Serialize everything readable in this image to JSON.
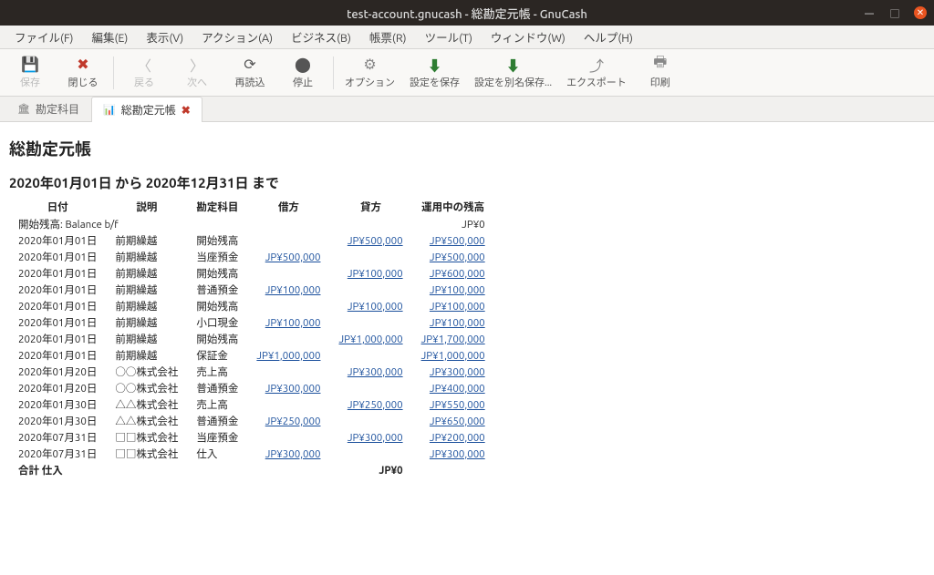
{
  "window": {
    "title": "test-account.gnucash - 総勘定元帳 - GnuCash"
  },
  "menu": {
    "file": "ファイル(F)",
    "edit": "編集(E)",
    "view": "表示(V)",
    "actions": "アクション(A)",
    "business": "ビジネス(B)",
    "reports": "帳票(R)",
    "tools": "ツール(T)",
    "windows": "ウィンドウ(W)",
    "help": "ヘルプ(H)"
  },
  "toolbar": {
    "save": "保存",
    "close": "閉じる",
    "back": "戻る",
    "forward": "次へ",
    "reload": "再読込",
    "stop": "停止",
    "options": "オプション",
    "save_settings": "設定を保存",
    "save_settings_as": "設定を別名保存...",
    "export": "エクスポート",
    "print": "印刷"
  },
  "tabs": {
    "accounts": "勘定科目",
    "ledger": "総勘定元帳"
  },
  "report": {
    "title": "総勘定元帳",
    "range": "2020年01月01日 から 2020年12月31日 まで",
    "headers": {
      "date": "日付",
      "desc": "説明",
      "account": "勘定科目",
      "debit": "借方",
      "credit": "貸方",
      "balance": "運用中の残高"
    },
    "opening_label": "開始残高: Balance b/f",
    "opening_balance": "JP¥0",
    "rows": [
      {
        "date": "2020年01月01日",
        "desc": "前期繰越",
        "acct": "開始残高",
        "debit": "",
        "credit": "JP¥500,000",
        "bal": "JP¥500,000"
      },
      {
        "date": "2020年01月01日",
        "desc": "前期繰越",
        "acct": "当座預金",
        "debit": "JP¥500,000",
        "credit": "",
        "bal": "JP¥500,000"
      },
      {
        "date": "2020年01月01日",
        "desc": "前期繰越",
        "acct": "開始残高",
        "debit": "",
        "credit": "JP¥100,000",
        "bal": "JP¥600,000"
      },
      {
        "date": "2020年01月01日",
        "desc": "前期繰越",
        "acct": "普通預金",
        "debit": "JP¥100,000",
        "credit": "",
        "bal": "JP¥100,000"
      },
      {
        "date": "2020年01月01日",
        "desc": "前期繰越",
        "acct": "開始残高",
        "debit": "",
        "credit": "JP¥100,000",
        "bal": "JP¥100,000"
      },
      {
        "date": "2020年01月01日",
        "desc": "前期繰越",
        "acct": "小口現金",
        "debit": "JP¥100,000",
        "credit": "",
        "bal": "JP¥100,000"
      },
      {
        "date": "2020年01月01日",
        "desc": "前期繰越",
        "acct": "開始残高",
        "debit": "",
        "credit": "JP¥1,000,000",
        "bal": "JP¥1,700,000"
      },
      {
        "date": "2020年01月01日",
        "desc": "前期繰越",
        "acct": "保証金",
        "debit": "JP¥1,000,000",
        "credit": "",
        "bal": "JP¥1,000,000"
      },
      {
        "date": "2020年01月20日",
        "desc": "○○株式会社",
        "acct": "売上高",
        "debit": "",
        "credit": "JP¥300,000",
        "bal": "JP¥300,000"
      },
      {
        "date": "2020年01月20日",
        "desc": "○○株式会社",
        "acct": "普通預金",
        "debit": "JP¥300,000",
        "credit": "",
        "bal": "JP¥400,000"
      },
      {
        "date": "2020年01月30日",
        "desc": "△△株式会社",
        "acct": "売上高",
        "debit": "",
        "credit": "JP¥250,000",
        "bal": "JP¥550,000"
      },
      {
        "date": "2020年01月30日",
        "desc": "△△株式会社",
        "acct": "普通預金",
        "debit": "JP¥250,000",
        "credit": "",
        "bal": "JP¥650,000"
      },
      {
        "date": "2020年07月31日",
        "desc": "□□株式会社",
        "acct": "当座預金",
        "debit": "",
        "credit": "JP¥300,000",
        "bal": "JP¥200,000"
      },
      {
        "date": "2020年07月31日",
        "desc": "□□株式会社",
        "acct": "仕入",
        "debit": "JP¥300,000",
        "credit": "",
        "bal": "JP¥300,000"
      }
    ],
    "total_label": "合計 仕入",
    "total_value": "JP¥0"
  }
}
